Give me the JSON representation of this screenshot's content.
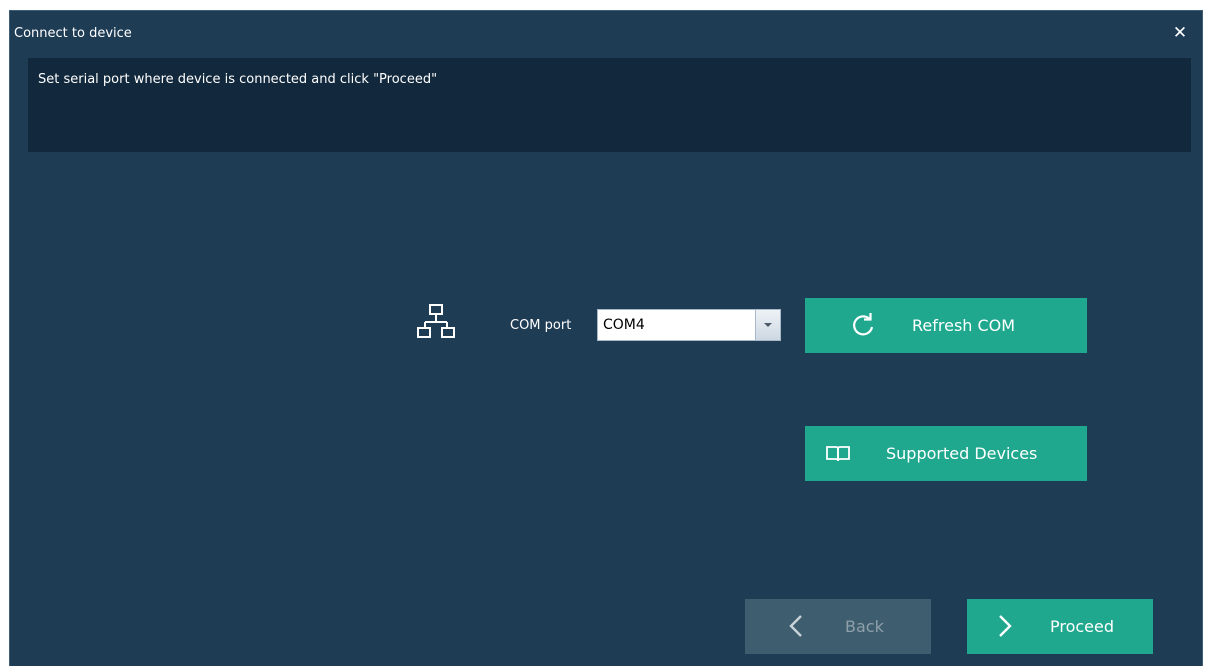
{
  "window": {
    "title": "Connect to device",
    "close_icon": "close-icon"
  },
  "banner": {
    "instruction": "Set serial port where device is connected and click \"Proceed\""
  },
  "connection": {
    "icon": "network-icon",
    "com_port_label": "COM port",
    "com_port_value": "COM4"
  },
  "buttons": {
    "refresh": {
      "label": "Refresh COM",
      "icon": "refresh-icon"
    },
    "supported": {
      "label": "Supported Devices",
      "icon": "book-icon"
    },
    "back": {
      "label": "Back",
      "icon": "chevron-left-icon",
      "enabled": false
    },
    "proceed": {
      "label": "Proceed",
      "icon": "chevron-right-icon",
      "enabled": true
    }
  },
  "colors": {
    "background": "#1f3c55",
    "banner": "#12293d",
    "accent": "#1fa88e",
    "disabled": "#3e5d6e"
  }
}
